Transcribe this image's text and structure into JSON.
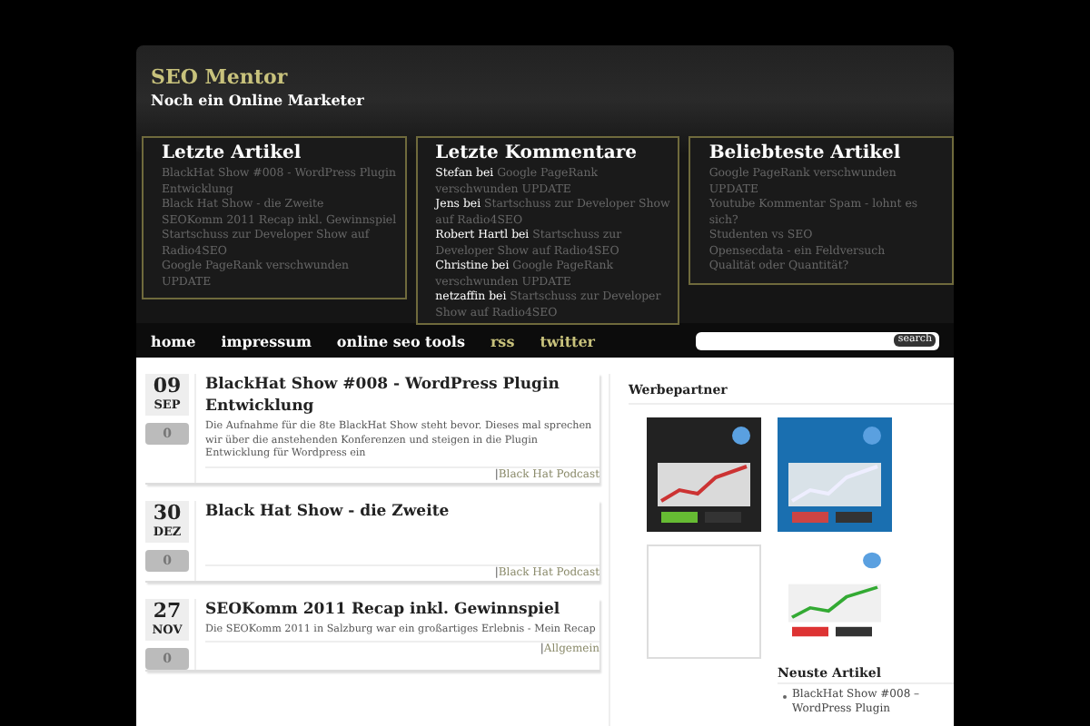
{
  "site": {
    "title": "SEO Mentor",
    "tagline": "Noch ein Online Marketer"
  },
  "widgets": [
    {
      "title": "Letzte Artikel",
      "kind": "links",
      "items": [
        {
          "link": "BlackHat Show #008 - WordPress Plugin Entwicklung"
        },
        {
          "link": "Black Hat Show - die Zweite"
        },
        {
          "link": "SEOKomm 2011 Recap inkl. Gewinnspiel"
        },
        {
          "link": "Startschuss zur Developer Show auf Radio4SEO"
        },
        {
          "link": "Google PageRank verschwunden UPDATE"
        }
      ]
    },
    {
      "title": "Letzte Kommentare",
      "kind": "comments",
      "items": [
        {
          "author": "Stefan",
          "sep": "bei",
          "link": "Google PageRank verschwunden UPDATE"
        },
        {
          "author": "Jens",
          "sep": "bei",
          "link": "Startschuss zur Developer Show auf Radio4SEO"
        },
        {
          "author": "Robert Hartl",
          "sep": "bei",
          "link": "Startschuss zur Developer Show auf Radio4SEO"
        },
        {
          "author": "Christine",
          "sep": "bei",
          "link": "Google PageRank verschwunden UPDATE"
        },
        {
          "author": "netzaffin",
          "sep": "bei",
          "link": "Startschuss zur Developer Show auf Radio4SEO"
        }
      ]
    },
    {
      "title": "Beliebteste Artikel",
      "kind": "links",
      "items": [
        {
          "link": "Google PageRank verschwunden UPDATE"
        },
        {
          "link": "Youtube Kommentar Spam - lohnt es sich?"
        },
        {
          "link": "Studenten vs SEO"
        },
        {
          "link": "Opensecdata - ein Feldversuch"
        },
        {
          "link": "Qualität oder Quantität?"
        }
      ]
    }
  ],
  "nav": [
    {
      "label": "home",
      "kind": "page"
    },
    {
      "label": "impressum",
      "kind": "page"
    },
    {
      "label": "online seo tools",
      "kind": "page"
    },
    {
      "label": "rss",
      "kind": "feed"
    },
    {
      "label": "twitter",
      "kind": "feed"
    }
  ],
  "search": {
    "button": "search"
  },
  "posts": [
    {
      "day": "09",
      "month": "SEP",
      "comments": "0",
      "title": "BlackHat Show #008 - WordPress Plugin Entwicklung",
      "excerpt": "Die Aufnahme für die 8te BlackHat Show steht bevor. Dieses mal sprechen wir über die anstehenden Konferenzen und steigen in die Plugin Entwicklung für Wordpress ein",
      "sep": "|",
      "category": "Black Hat Podcast"
    },
    {
      "day": "30",
      "month": "DEZ",
      "comments": "0",
      "title": "Black Hat Show - die Zweite",
      "sep": "|",
      "category": "Black Hat Podcast"
    },
    {
      "day": "27",
      "month": "NOV",
      "comments": "0",
      "title": "SEOKomm 2011 Recap inkl. Gewinnspiel",
      "excerpt": "Die SEOKomm 2011 in Salzburg war ein großartiges Erlebnis - Mein Recap",
      "sep": "|",
      "category": "Allgemein"
    }
  ],
  "sidebar": {
    "title": "Werbepartner",
    "ads": [
      {
        "kind": "picture"
      },
      {
        "kind": "picture"
      },
      {
        "kind": "blank"
      },
      {
        "kind": "picture"
      }
    ],
    "recent_title": "Neuste Artikel",
    "recent": [
      "BlackHat Show #008 – WordPress Plugin"
    ]
  }
}
